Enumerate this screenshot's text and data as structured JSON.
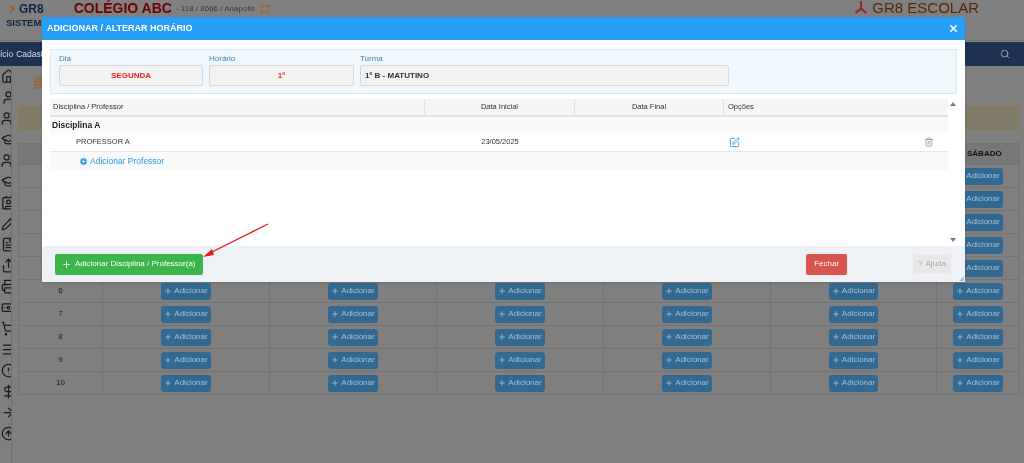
{
  "header": {
    "logo_top": "GR8",
    "logo_bottom": "SISTEM",
    "school": "COLÉGIO ABC",
    "school_info": "- 118 / 8666 / Anápolis",
    "brand": "GR8 ESCOLAR"
  },
  "nav": {
    "items": [
      "ício",
      "Cadast"
    ]
  },
  "schedule": {
    "last_column": "SÁBADO",
    "rows": [
      {
        "saturday": "Adicionar"
      },
      {
        "saturday": "Adicionar"
      },
      {
        "saturday": "Adicionar"
      },
      {
        "saturday": "Adicionar"
      },
      {
        "saturday": "Adicionar"
      },
      {
        "number": "6",
        "days": [
          "Adicionar",
          "Adicionar",
          "Adicionar",
          "Adicionar",
          "Adicionar"
        ],
        "saturday": "Adicionar"
      },
      {
        "number": "7",
        "days": [
          "Adicionar",
          "Adicionar",
          "Adicionar",
          "Adicionar",
          "Adicionar"
        ],
        "saturday": "Adicionar"
      },
      {
        "number": "8",
        "days": [
          "Adicionar",
          "Adicionar",
          "Adicionar",
          "Adicionar",
          "Adicionar"
        ],
        "saturday": "Adicionar"
      },
      {
        "number": "9",
        "days": [
          "Adicionar",
          "Adicionar",
          "Adicionar",
          "Adicionar",
          "Adicionar"
        ],
        "saturday": "Adicionar"
      },
      {
        "number": "10",
        "days": [
          "Adicionar",
          "Adicionar",
          "Adicionar",
          "Adicionar",
          "Adicionar"
        ],
        "saturday": "Adicionar"
      }
    ]
  },
  "modal": {
    "title": "ADICIONAR / ALTERAR HORÁRIO",
    "fields": [
      {
        "label": "Dia",
        "value": "SEGUNDA",
        "kind": "highlight"
      },
      {
        "label": "Horário",
        "value": "1º",
        "kind": "highlight"
      },
      {
        "label": "Turma",
        "value": "1º B - MATUTINO",
        "kind": "plain"
      }
    ],
    "table": {
      "columns": [
        "Disciplina / Professor",
        "Data Inicial",
        "Data Final",
        "Opções"
      ],
      "groups": [
        {
          "name": "Disciplina A",
          "rows": [
            {
              "professor": "PROFESSOR A",
              "start": "23/05/2025"
            }
          ],
          "add_link": "Adicionar Professor"
        }
      ]
    },
    "add_button": "Adicionar Disciplina / Professor(a)",
    "close_button": "Fechar",
    "help_button": {
      "icon": "?",
      "label": "Ajuda",
      "disabled": true
    }
  }
}
